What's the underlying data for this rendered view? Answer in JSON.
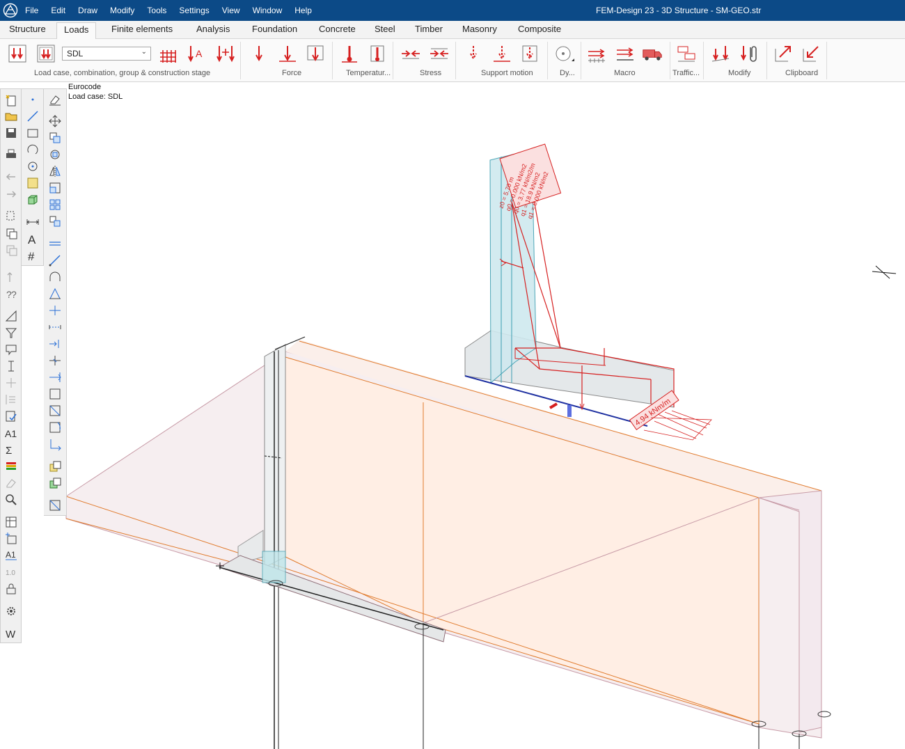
{
  "titlebar": {
    "title": "FEM-Design 23 - 3D Structure - SM-GEO.str",
    "menu": [
      "File",
      "Edit",
      "Draw",
      "Modify",
      "Tools",
      "Settings",
      "View",
      "Window",
      "Help"
    ]
  },
  "tabs": [
    {
      "label": "Structure"
    },
    {
      "label": "Loads",
      "active": true
    },
    {
      "label": "Finite elements"
    },
    {
      "label": "Analysis"
    },
    {
      "label": "Foundation"
    },
    {
      "label": "Concrete"
    },
    {
      "label": "Steel"
    },
    {
      "label": "Timber"
    },
    {
      "label": "Masonry"
    },
    {
      "label": "Composite"
    }
  ],
  "ribbon": {
    "load_case_value": "SDL",
    "groups": [
      "Load case, combination, group  & construction stage",
      "Force",
      "Temperatur...",
      "Stress",
      "Support motion",
      "Dy...",
      "Macro",
      "Traffic...",
      "Modify",
      "Clipboard"
    ]
  },
  "viewport": {
    "info_line1": "Eurocode",
    "info_line2": "Load case: SDL",
    "load_label_line": "4.94 kNm/m",
    "load_label_soil": [
      "z0 = 5.70 m",
      "q0 = 0.000 kN/m2",
      "q0 = 3.77 kN/m2/m",
      "q1 = 18.9 kN/m2",
      "q1 = 0.000 kN/m2"
    ]
  },
  "colors": {
    "titlebar": "#0c4a87",
    "accent_red": "#d62020",
    "slab_fill": "#ffeee4",
    "slab_edge": "#e07a2c",
    "wall_fill": "#cfe9ef"
  }
}
